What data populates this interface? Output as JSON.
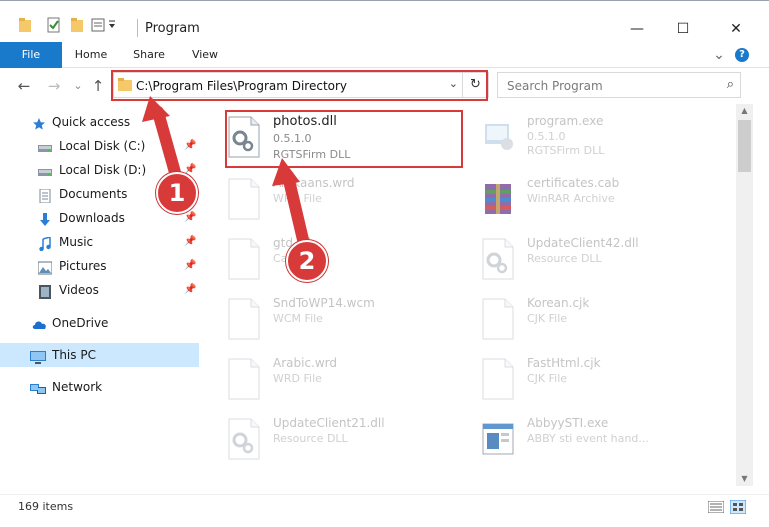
{
  "window": {
    "title": "Program",
    "minimize": "—",
    "maximize": "☐",
    "close": "✕"
  },
  "ribbon": {
    "tabs": [
      "File",
      "Home",
      "Share",
      "View"
    ],
    "collapse": "⌄",
    "help": "?"
  },
  "address": {
    "path": "C:\\Program Files\\Program Directory",
    "dropdown": "⌄",
    "refresh": "↻"
  },
  "search": {
    "placeholder": "Search Program",
    "icon": "⌕"
  },
  "nav_icons": {
    "back": "←",
    "forward": "→",
    "recent": "⌄",
    "up": "↑"
  },
  "sidebar": {
    "items": [
      {
        "label": "Quick access",
        "icon": "star-icon",
        "pinned": false
      },
      {
        "label": "Local Disk (C:)",
        "icon": "drive-icon",
        "pinned": true
      },
      {
        "label": "Local Disk (D:)",
        "icon": "drive-icon",
        "pinned": true
      },
      {
        "label": "Documents",
        "icon": "documents-icon",
        "pinned": true
      },
      {
        "label": "Downloads",
        "icon": "downloads-icon",
        "pinned": true
      },
      {
        "label": "Music",
        "icon": "music-icon",
        "pinned": true
      },
      {
        "label": "Pictures",
        "icon": "pictures-icon",
        "pinned": true
      },
      {
        "label": "Videos",
        "icon": "videos-icon",
        "pinned": true
      },
      {
        "label": "OneDrive",
        "icon": "onedrive-icon",
        "pinned": false
      },
      {
        "label": "This PC",
        "icon": "this-pc-icon",
        "pinned": false
      },
      {
        "label": "Network",
        "icon": "network-icon",
        "pinned": false
      }
    ],
    "pin_glyph": "📌"
  },
  "files": [
    {
      "name": "photos.dll",
      "line1": "0.5.1.0",
      "line2": "RGTSFirm DLL",
      "icon": "dll-gear-icon",
      "highlighted": true
    },
    {
      "name": "program.exe",
      "line1": "0.5.1.0",
      "line2": "RGTSFirm DLL",
      "icon": "exe-icon",
      "highlighted": false
    },
    {
      "name": "Afrikaans.wrd",
      "line1": "WRD File",
      "line2": "",
      "icon": "blank-file-icon",
      "highlighted": false
    },
    {
      "name": "certificates.cab",
      "line1": "WinRAR Archive",
      "line2": "",
      "icon": "archive-icon",
      "highlighted": false
    },
    {
      "name": "gtd.dll",
      "line1": "Cab File",
      "line2": "",
      "icon": "blank-file-icon",
      "highlighted": false
    },
    {
      "name": "UpdateClient42.dll",
      "line1": "Resource DLL",
      "line2": "",
      "icon": "dll-gear-icon",
      "highlighted": false
    },
    {
      "name": "SndToWP14.wcm",
      "line1": "WCM File",
      "line2": "",
      "icon": "blank-file-icon",
      "highlighted": false
    },
    {
      "name": "Korean.cjk",
      "line1": "CJK File",
      "line2": "",
      "icon": "blank-file-icon",
      "highlighted": false
    },
    {
      "name": "Arabic.wrd",
      "line1": "WRD File",
      "line2": "",
      "icon": "blank-file-icon",
      "highlighted": false
    },
    {
      "name": "FastHtml.cjk",
      "line1": "CJK File",
      "line2": "",
      "icon": "blank-file-icon",
      "highlighted": false
    },
    {
      "name": "UpdateClient21.dll",
      "line1": "Resource DLL",
      "line2": "",
      "icon": "dll-gear-icon",
      "highlighted": false
    },
    {
      "name": "AbbyySTI.exe",
      "line1": "ABBY sti event hand...",
      "line2": "",
      "icon": "app-window-icon",
      "highlighted": false
    }
  ],
  "status": {
    "count": "169 items"
  },
  "callouts": [
    "1",
    "2"
  ],
  "colors": {
    "accent": "#1979ca",
    "highlight_box": "#d83a3a",
    "selection": "#cce8ff"
  }
}
